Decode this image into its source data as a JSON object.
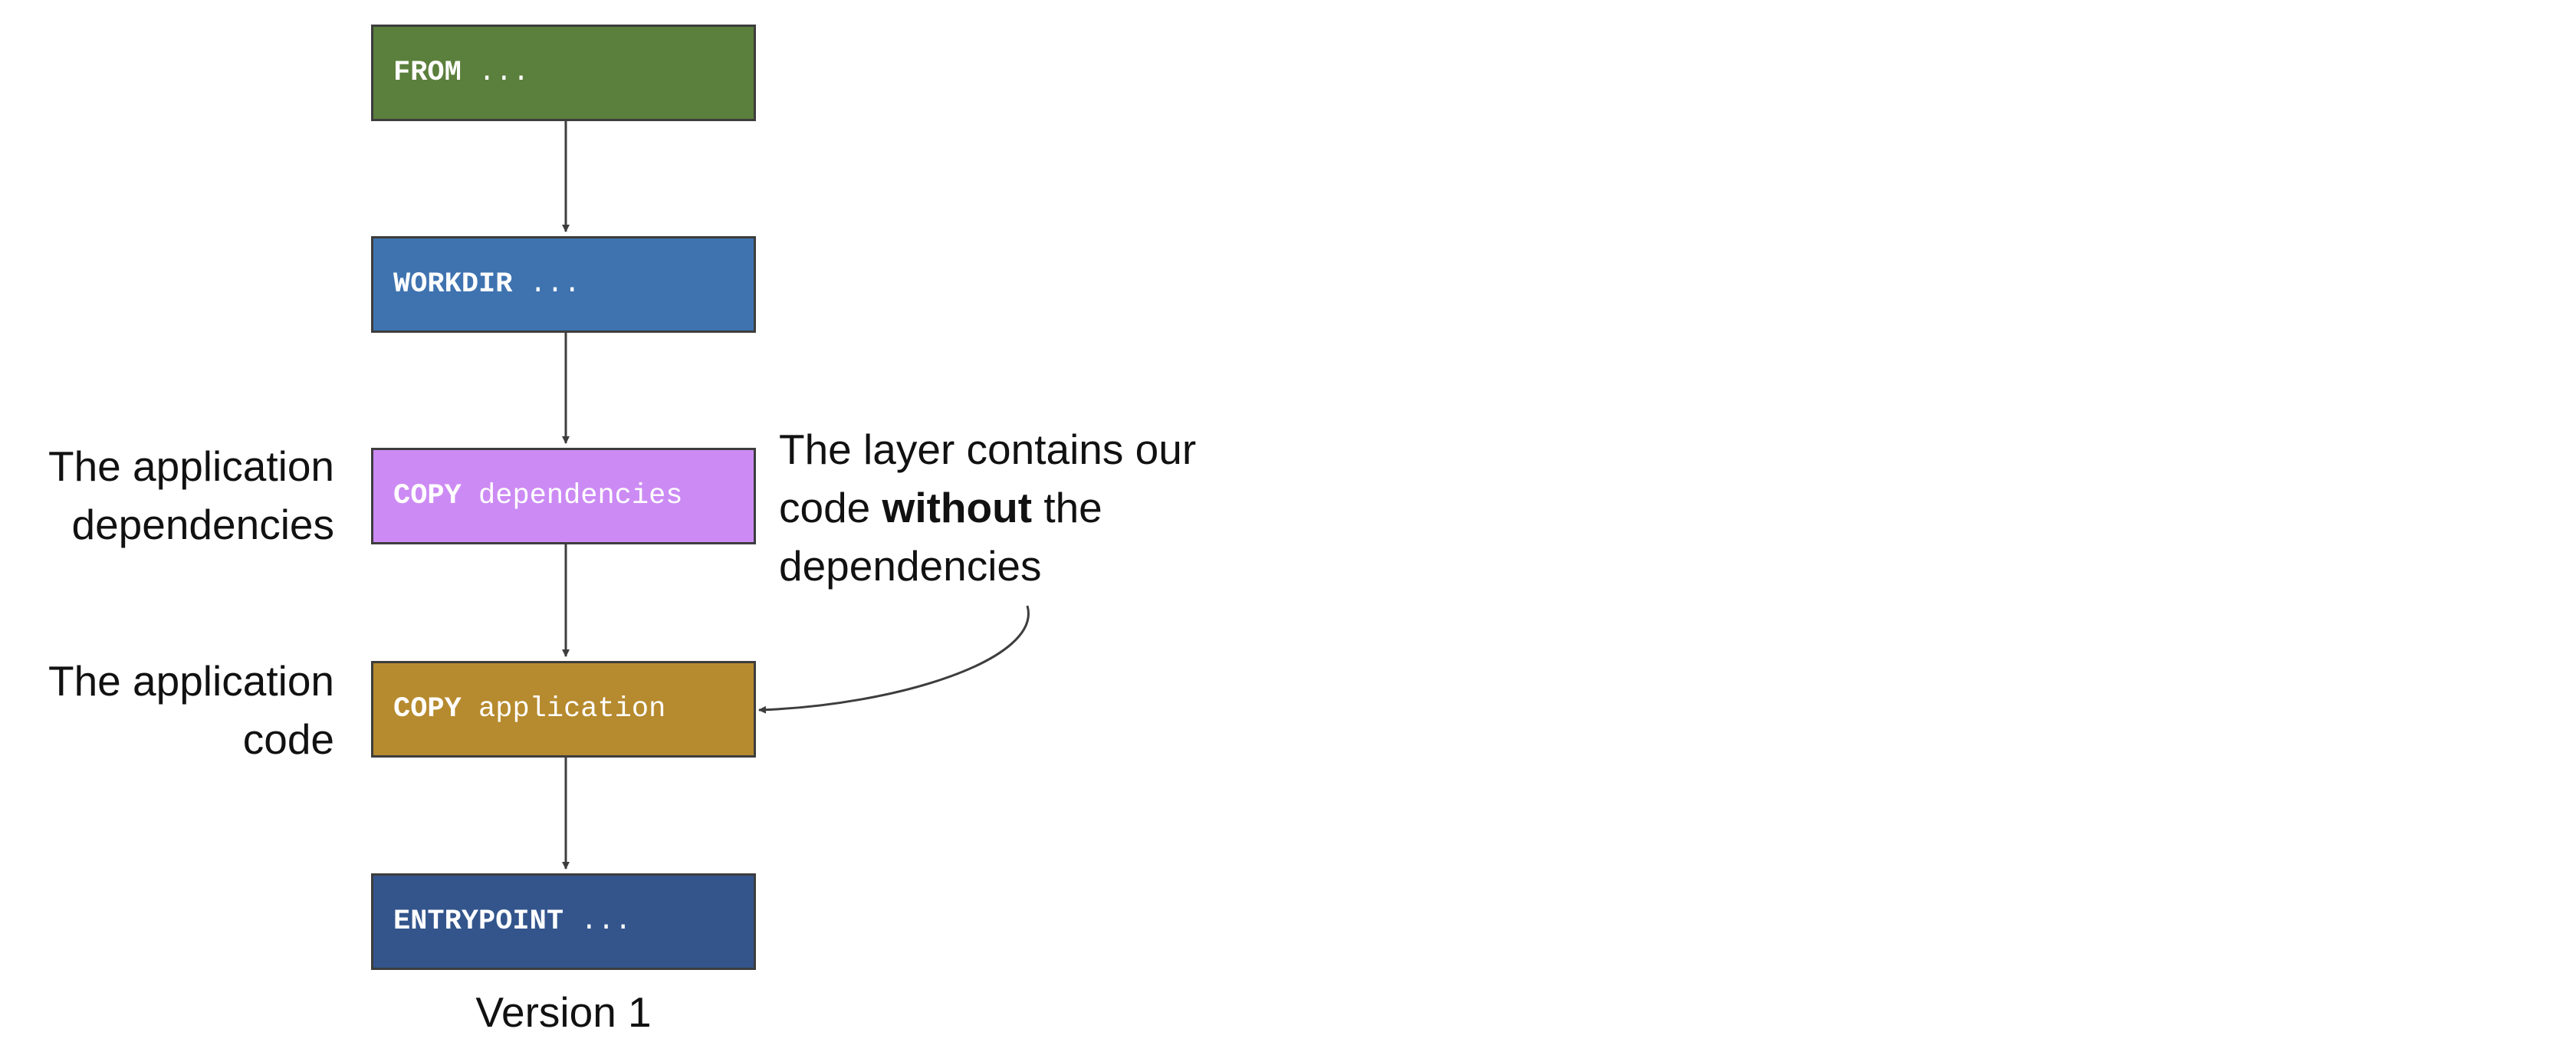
{
  "layers": [
    {
      "keyword": "FROM",
      "arg": "...",
      "color": "#5b7f3c"
    },
    {
      "keyword": "WORKDIR",
      "arg": "...",
      "color": "#3f73b0"
    },
    {
      "keyword": "COPY",
      "arg": "dependencies",
      "color": "#cc8bf4"
    },
    {
      "keyword": "COPY",
      "arg": "application",
      "color": "#b68a2e"
    },
    {
      "keyword": "ENTRYPOINT",
      "arg": "...",
      "color": "#33558c"
    }
  ],
  "labels": {
    "dependencies": {
      "line1": "The application",
      "line2": "dependencies"
    },
    "code": {
      "line1": "The application",
      "line2": "code"
    }
  },
  "annotation": {
    "line1": "The layer contains our",
    "line2_before": "code",
    "line2_bold": "without",
    "line2_after": "the",
    "line3": "dependencies"
  },
  "caption": "Version 1",
  "colors": {
    "arrow": "#3d3d3d",
    "text": "#111111"
  }
}
